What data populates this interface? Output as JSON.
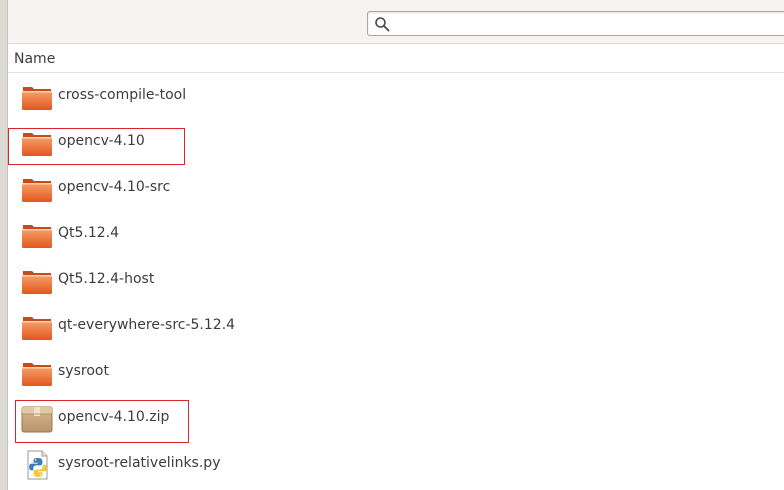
{
  "search": {
    "value": "",
    "placeholder": "",
    "icon": "search-icon"
  },
  "columns": {
    "name": "Name"
  },
  "files": [
    {
      "name": "cross-compile-tool",
      "type": "folder",
      "icon": "folder-icon"
    },
    {
      "name": "opencv-4.10",
      "type": "folder",
      "icon": "folder-icon"
    },
    {
      "name": "opencv-4.10-src",
      "type": "folder",
      "icon": "folder-icon"
    },
    {
      "name": "Qt5.12.4",
      "type": "folder",
      "icon": "folder-icon"
    },
    {
      "name": "Qt5.12.4-host",
      "type": "folder",
      "icon": "folder-icon"
    },
    {
      "name": "qt-everywhere-src-5.12.4",
      "type": "folder",
      "icon": "folder-icon"
    },
    {
      "name": "sysroot",
      "type": "folder",
      "icon": "folder-icon"
    },
    {
      "name": "opencv-4.10.zip",
      "type": "archive",
      "icon": "archive-icon"
    },
    {
      "name": "sysroot-relativelinks.py",
      "type": "python",
      "icon": "python-file-icon"
    }
  ],
  "annotations": {
    "highlight_color": "#d9262c",
    "highlighted_items": [
      "opencv-4.10",
      "opencv-4.10.zip"
    ]
  },
  "colors": {
    "folder_light": "#f6a06b",
    "folder_dark": "#e2561e",
    "archive": "#c8a77e"
  }
}
